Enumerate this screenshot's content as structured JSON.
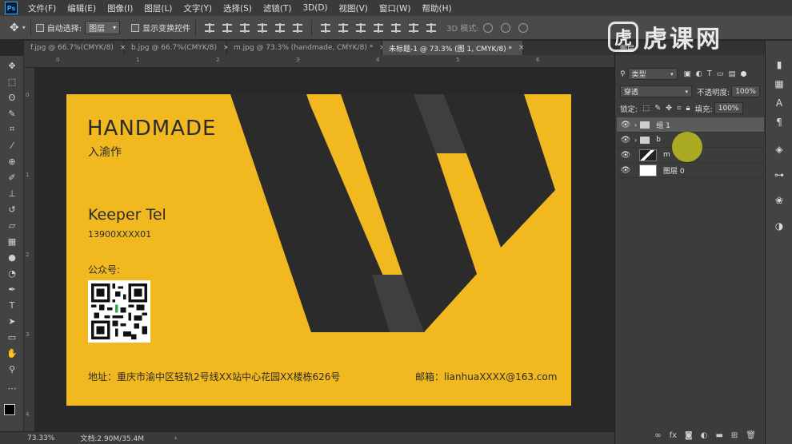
{
  "menu": {
    "items": [
      "文件(F)",
      "编辑(E)",
      "图像(I)",
      "图层(L)",
      "文字(Y)",
      "选择(S)",
      "滤镜(T)",
      "3D(D)",
      "视图(V)",
      "窗口(W)",
      "帮助(H)"
    ]
  },
  "options": {
    "auto_select_label": "自动选择:",
    "auto_select_value": "图层",
    "show_transform_label": "显示变换控件",
    "mode_3d_label": "3D 模式:"
  },
  "watermark": {
    "logo_glyph": "虎",
    "text": "虎课网"
  },
  "tabs": [
    {
      "label": "f.jpg @ 66.7%(CMYK/8)",
      "close": "×"
    },
    {
      "label": "b.jpg @ 66.7%(CMYK/8)",
      "close": "×"
    },
    {
      "label": "m.jpg @ 73.3% (handmade, CMYK/8) *",
      "close": "×"
    },
    {
      "label": "未标题-1 @ 73.3% (图 1, CMYK/8) *",
      "close": "×"
    }
  ],
  "card": {
    "brand_title": "HANDMADE",
    "brand_sub": "入渝作",
    "person": "Keeper Tel",
    "phone": "13900XXXX01",
    "wechat_label": "公众号:",
    "address": "地址：重庆市渝中区轻轨2号线XX站中心花园XX楼栋626号",
    "email": "邮箱：lianhuaXXXX@163.com",
    "colors": {
      "background": "#f2b820",
      "dark": "#2b2b2b",
      "gray": "#3f3f3f"
    }
  },
  "status": {
    "zoom": "73.33%",
    "doc_info": "文档:2.90M/35.4M"
  },
  "layers_panel": {
    "title": "图层",
    "filter_kind": "类型",
    "blend_mode": "穿透",
    "opacity_label": "不透明度:",
    "opacity_value": "100%",
    "lock_label": "锁定:",
    "fill_label": "填充:",
    "fill_value": "100%",
    "layers": [
      {
        "name": "组 1",
        "type": "group",
        "selected": true
      },
      {
        "name": "b",
        "type": "group",
        "selected": false
      },
      {
        "name": "m",
        "type": "layer",
        "selected": false
      },
      {
        "name": "图层 0",
        "type": "layer",
        "selected": false
      }
    ],
    "footer_icons": [
      "link-icon",
      "fx-icon",
      "mask-icon",
      "adjustment-icon",
      "folder-icon",
      "new-layer-icon",
      "trash-icon"
    ]
  },
  "tool_icons": [
    "move-icon",
    "marquee-icon",
    "lasso-icon",
    "crop-icon",
    "eyedropper-icon",
    "healing-icon",
    "brush-icon",
    "stamp-icon",
    "history-brush-icon",
    "eraser-icon",
    "gradient-icon",
    "blur-icon",
    "dodge-icon",
    "pen-icon",
    "type-icon",
    "path-select-icon",
    "rectangle-icon",
    "hand-icon",
    "zoom-icon"
  ]
}
